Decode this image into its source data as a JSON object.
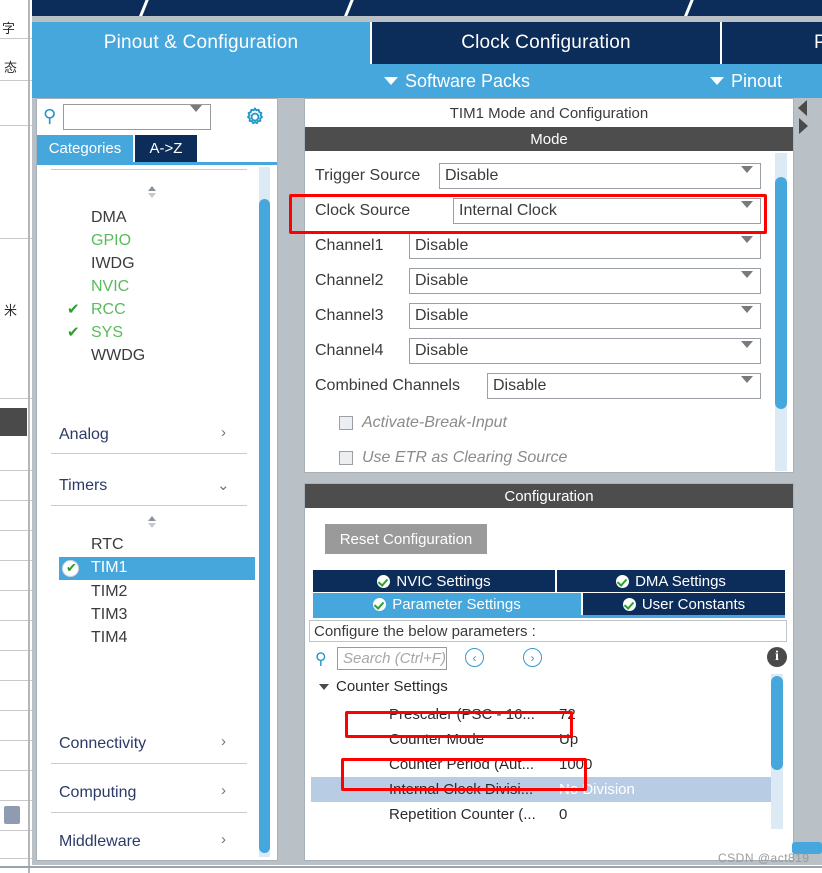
{
  "app": {
    "main_tabs": [
      {
        "id": "pinout-configuration",
        "label": "Pinout & Configuration",
        "active": true
      },
      {
        "id": "clock-configuration",
        "label": "Clock Configuration",
        "active": false
      },
      {
        "id": "project-manager",
        "label": "P",
        "active": false
      }
    ],
    "sub_bar": [
      {
        "id": "software-packs",
        "label": "Software Packs"
      },
      {
        "id": "pinout",
        "label": "Pinout"
      }
    ]
  },
  "sidebar": {
    "search": {
      "value": "",
      "placeholder": ""
    },
    "gear_icon": "gear-icon",
    "view_tabs": [
      {
        "id": "categories",
        "label": "Categories",
        "selected": true
      },
      {
        "id": "a-to-z",
        "label": "A->Z",
        "selected": false
      }
    ],
    "system_core": {
      "items": [
        {
          "label": "DMA",
          "state": "plain",
          "checked": false
        },
        {
          "label": "GPIO",
          "state": "configured",
          "checked": false
        },
        {
          "label": "IWDG",
          "state": "plain",
          "checked": false
        },
        {
          "label": "NVIC",
          "state": "configured",
          "checked": false
        },
        {
          "label": "RCC",
          "state": "configured",
          "checked": true
        },
        {
          "label": "SYS",
          "state": "configured",
          "checked": true
        },
        {
          "label": "WWDG",
          "state": "plain",
          "checked": false
        }
      ]
    },
    "groups": [
      {
        "id": "analog",
        "label": "Analog",
        "expanded": false
      },
      {
        "id": "timers",
        "label": "Timers",
        "expanded": true
      },
      {
        "id": "connectivity",
        "label": "Connectivity",
        "expanded": false
      },
      {
        "id": "computing",
        "label": "Computing",
        "expanded": false
      },
      {
        "id": "middleware",
        "label": "Middleware",
        "expanded": false
      }
    ],
    "timers": {
      "items": [
        {
          "label": "RTC",
          "selected": false,
          "checked": false
        },
        {
          "label": "TIM1",
          "selected": true,
          "checked": true
        },
        {
          "label": "TIM2",
          "selected": false,
          "checked": false
        },
        {
          "label": "TIM3",
          "selected": false,
          "checked": false
        },
        {
          "label": "TIM4",
          "selected": false,
          "checked": false
        }
      ]
    }
  },
  "main": {
    "panel_title": "TIM1 Mode and Configuration",
    "mode": {
      "header": "Mode",
      "fields": [
        {
          "id": "trigger-source",
          "label": "Trigger Source",
          "value": "Disable"
        },
        {
          "id": "clock-source",
          "label": "Clock Source",
          "value": "Internal Clock"
        },
        {
          "id": "channel1",
          "label": "Channel1",
          "value": "Disable"
        },
        {
          "id": "channel2",
          "label": "Channel2",
          "value": "Disable"
        },
        {
          "id": "channel3",
          "label": "Channel3",
          "value": "Disable"
        },
        {
          "id": "channel4",
          "label": "Channel4",
          "value": "Disable"
        },
        {
          "id": "combined-channels",
          "label": "Combined Channels",
          "value": "Disable"
        }
      ],
      "checkboxes": [
        {
          "id": "activate-break-input",
          "label": "Activate-Break-Input",
          "checked": false,
          "enabled": false
        },
        {
          "id": "use-etr-clearing-source",
          "label": "Use ETR as Clearing Source",
          "checked": false,
          "enabled": false
        }
      ]
    },
    "configuration": {
      "header": "Configuration",
      "reset_button": "Reset Configuration",
      "tabs_row1": [
        {
          "id": "nvic-settings",
          "label": "NVIC Settings",
          "active": false
        },
        {
          "id": "dma-settings",
          "label": "DMA Settings",
          "active": false
        }
      ],
      "tabs_row2": [
        {
          "id": "parameter-settings",
          "label": "Parameter Settings",
          "active": true
        },
        {
          "id": "user-constants",
          "label": "User Constants",
          "active": false
        }
      ],
      "note": "Configure the below parameters :",
      "search": {
        "value": "",
        "placeholder": "Search (Ctrl+F)"
      },
      "nav_prev": "‹",
      "nav_next": "›",
      "info_icon": "info-icon",
      "group": {
        "label": "Counter Settings",
        "expanded": true
      },
      "parameters": [
        {
          "id": "prescaler",
          "name": "Prescaler (PSC - 16...",
          "value": "72",
          "selected": false
        },
        {
          "id": "counter-mode",
          "name": "Counter Mode",
          "value": "Up",
          "selected": false
        },
        {
          "id": "counter-period",
          "name": "Counter Period (Aut...",
          "value": "1000",
          "selected": false
        },
        {
          "id": "internal-clock-division",
          "name": "Internal Clock Divisi...",
          "value": "No Division",
          "selected": true
        },
        {
          "id": "repetition-counter",
          "name": "Repetition Counter (...",
          "value": "0",
          "selected": false
        }
      ]
    }
  },
  "annotations": {
    "highlight_color": "#ff0000",
    "boxes": [
      {
        "id": "clock-source-highlight",
        "target": "clock-source"
      },
      {
        "id": "prescaler-highlight",
        "target": "prescaler"
      },
      {
        "id": "counter-period-highlight",
        "target": "counter-period"
      }
    ]
  },
  "watermark": "CSDN @act819",
  "background_text": [
    "字",
    "态",
    "米"
  ],
  "colors": {
    "accent_blue": "#46a7dd",
    "navy": "#0c2d5a",
    "band_gray": "#4d4d4d",
    "selected_row": "#b8cce4",
    "green": "#5bba5b"
  }
}
